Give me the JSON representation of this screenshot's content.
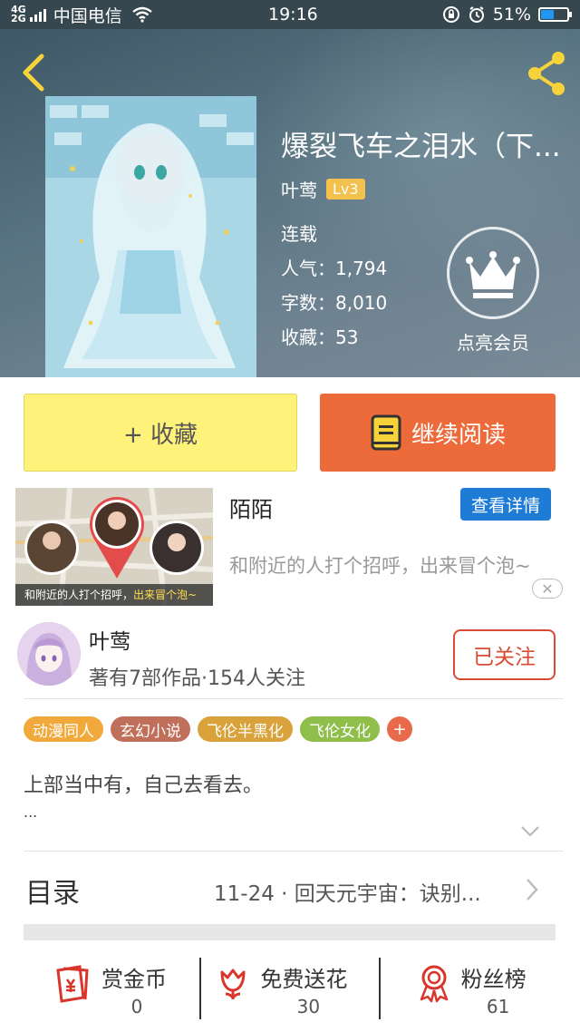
{
  "status_bar": {
    "network": "4G 2G",
    "carrier": "中国电信",
    "time": "19:16",
    "battery": "51%",
    "battery_level": 0.51
  },
  "book": {
    "title": "爆裂飞车之泪水（下...",
    "author": "叶莺",
    "level": "Lv3",
    "status": "连载",
    "popularity": "人气：1,794",
    "word_count": "字数：8,010",
    "favorites": "收藏：53",
    "vip_label": "点亮会员"
  },
  "actions": {
    "favorite_label": "+ 收藏",
    "read_label": "继续阅读"
  },
  "ad": {
    "caption_prefix": "和附近的人打个招呼，",
    "caption_highlight": "出来冒个泡~",
    "app_name": "陌陌",
    "detail_button": "查看详情",
    "description": "和附近的人打个招呼，出来冒个泡~",
    "close": "✕"
  },
  "author": {
    "name": "叶莺",
    "stats": "著有7部作品·154人关注",
    "follow_label": "已关注"
  },
  "tags": [
    {
      "label": "动漫同人",
      "color": "#f2a93b"
    },
    {
      "label": "玄幻小说",
      "color": "#c0705a"
    },
    {
      "label": "飞伦半黑化",
      "color": "#d9a23a"
    },
    {
      "label": "飞伦女化",
      "color": "#8fbf4a"
    }
  ],
  "tag_add": "+",
  "summary": {
    "text": "上部当中有，自己去看去。",
    "more": "..."
  },
  "toc": {
    "label": "目录",
    "latest": "11-24 · 回天元宇宙：诀别..."
  },
  "bottom_bar": [
    {
      "label": "赏金币",
      "count": "0",
      "icon": "gold-coin-icon"
    },
    {
      "label": "免费送花",
      "count": "30",
      "icon": "flower-icon"
    },
    {
      "label": "粉丝榜",
      "count": "61",
      "icon": "medal-icon"
    }
  ],
  "colors": {
    "accent_orange": "#ed6a3a",
    "favorite_yellow": "#fff27a",
    "ad_blue": "#1e7cd6",
    "follow_red": "#d94b32",
    "level_badge": "#f2c14e"
  }
}
